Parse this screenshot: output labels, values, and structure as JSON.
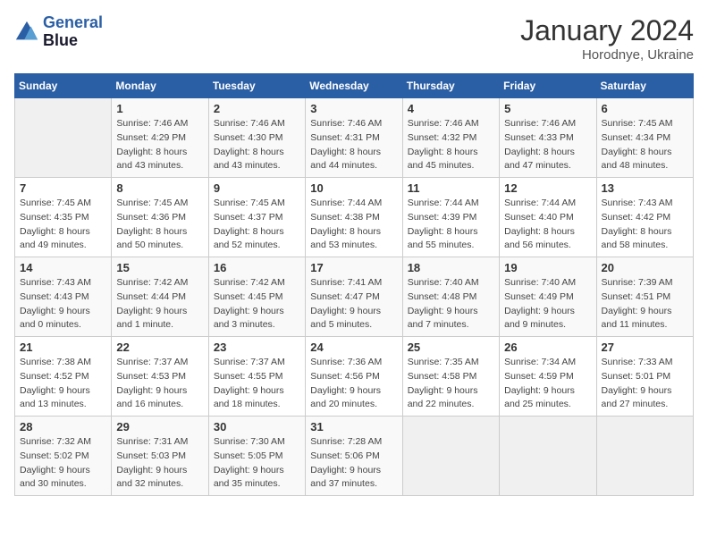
{
  "header": {
    "logo_line1": "General",
    "logo_line2": "Blue",
    "month_year": "January 2024",
    "location": "Horodnye, Ukraine"
  },
  "weekdays": [
    "Sunday",
    "Monday",
    "Tuesday",
    "Wednesday",
    "Thursday",
    "Friday",
    "Saturday"
  ],
  "weeks": [
    [
      {
        "day": "",
        "sunrise": "",
        "sunset": "",
        "daylight": ""
      },
      {
        "day": "1",
        "sunrise": "Sunrise: 7:46 AM",
        "sunset": "Sunset: 4:29 PM",
        "daylight": "Daylight: 8 hours and 43 minutes."
      },
      {
        "day": "2",
        "sunrise": "Sunrise: 7:46 AM",
        "sunset": "Sunset: 4:30 PM",
        "daylight": "Daylight: 8 hours and 43 minutes."
      },
      {
        "day": "3",
        "sunrise": "Sunrise: 7:46 AM",
        "sunset": "Sunset: 4:31 PM",
        "daylight": "Daylight: 8 hours and 44 minutes."
      },
      {
        "day": "4",
        "sunrise": "Sunrise: 7:46 AM",
        "sunset": "Sunset: 4:32 PM",
        "daylight": "Daylight: 8 hours and 45 minutes."
      },
      {
        "day": "5",
        "sunrise": "Sunrise: 7:46 AM",
        "sunset": "Sunset: 4:33 PM",
        "daylight": "Daylight: 8 hours and 47 minutes."
      },
      {
        "day": "6",
        "sunrise": "Sunrise: 7:45 AM",
        "sunset": "Sunset: 4:34 PM",
        "daylight": "Daylight: 8 hours and 48 minutes."
      }
    ],
    [
      {
        "day": "7",
        "sunrise": "Sunrise: 7:45 AM",
        "sunset": "Sunset: 4:35 PM",
        "daylight": "Daylight: 8 hours and 49 minutes."
      },
      {
        "day": "8",
        "sunrise": "Sunrise: 7:45 AM",
        "sunset": "Sunset: 4:36 PM",
        "daylight": "Daylight: 8 hours and 50 minutes."
      },
      {
        "day": "9",
        "sunrise": "Sunrise: 7:45 AM",
        "sunset": "Sunset: 4:37 PM",
        "daylight": "Daylight: 8 hours and 52 minutes."
      },
      {
        "day": "10",
        "sunrise": "Sunrise: 7:44 AM",
        "sunset": "Sunset: 4:38 PM",
        "daylight": "Daylight: 8 hours and 53 minutes."
      },
      {
        "day": "11",
        "sunrise": "Sunrise: 7:44 AM",
        "sunset": "Sunset: 4:39 PM",
        "daylight": "Daylight: 8 hours and 55 minutes."
      },
      {
        "day": "12",
        "sunrise": "Sunrise: 7:44 AM",
        "sunset": "Sunset: 4:40 PM",
        "daylight": "Daylight: 8 hours and 56 minutes."
      },
      {
        "day": "13",
        "sunrise": "Sunrise: 7:43 AM",
        "sunset": "Sunset: 4:42 PM",
        "daylight": "Daylight: 8 hours and 58 minutes."
      }
    ],
    [
      {
        "day": "14",
        "sunrise": "Sunrise: 7:43 AM",
        "sunset": "Sunset: 4:43 PM",
        "daylight": "Daylight: 9 hours and 0 minutes."
      },
      {
        "day": "15",
        "sunrise": "Sunrise: 7:42 AM",
        "sunset": "Sunset: 4:44 PM",
        "daylight": "Daylight: 9 hours and 1 minute."
      },
      {
        "day": "16",
        "sunrise": "Sunrise: 7:42 AM",
        "sunset": "Sunset: 4:45 PM",
        "daylight": "Daylight: 9 hours and 3 minutes."
      },
      {
        "day": "17",
        "sunrise": "Sunrise: 7:41 AM",
        "sunset": "Sunset: 4:47 PM",
        "daylight": "Daylight: 9 hours and 5 minutes."
      },
      {
        "day": "18",
        "sunrise": "Sunrise: 7:40 AM",
        "sunset": "Sunset: 4:48 PM",
        "daylight": "Daylight: 9 hours and 7 minutes."
      },
      {
        "day": "19",
        "sunrise": "Sunrise: 7:40 AM",
        "sunset": "Sunset: 4:49 PM",
        "daylight": "Daylight: 9 hours and 9 minutes."
      },
      {
        "day": "20",
        "sunrise": "Sunrise: 7:39 AM",
        "sunset": "Sunset: 4:51 PM",
        "daylight": "Daylight: 9 hours and 11 minutes."
      }
    ],
    [
      {
        "day": "21",
        "sunrise": "Sunrise: 7:38 AM",
        "sunset": "Sunset: 4:52 PM",
        "daylight": "Daylight: 9 hours and 13 minutes."
      },
      {
        "day": "22",
        "sunrise": "Sunrise: 7:37 AM",
        "sunset": "Sunset: 4:53 PM",
        "daylight": "Daylight: 9 hours and 16 minutes."
      },
      {
        "day": "23",
        "sunrise": "Sunrise: 7:37 AM",
        "sunset": "Sunset: 4:55 PM",
        "daylight": "Daylight: 9 hours and 18 minutes."
      },
      {
        "day": "24",
        "sunrise": "Sunrise: 7:36 AM",
        "sunset": "Sunset: 4:56 PM",
        "daylight": "Daylight: 9 hours and 20 minutes."
      },
      {
        "day": "25",
        "sunrise": "Sunrise: 7:35 AM",
        "sunset": "Sunset: 4:58 PM",
        "daylight": "Daylight: 9 hours and 22 minutes."
      },
      {
        "day": "26",
        "sunrise": "Sunrise: 7:34 AM",
        "sunset": "Sunset: 4:59 PM",
        "daylight": "Daylight: 9 hours and 25 minutes."
      },
      {
        "day": "27",
        "sunrise": "Sunrise: 7:33 AM",
        "sunset": "Sunset: 5:01 PM",
        "daylight": "Daylight: 9 hours and 27 minutes."
      }
    ],
    [
      {
        "day": "28",
        "sunrise": "Sunrise: 7:32 AM",
        "sunset": "Sunset: 5:02 PM",
        "daylight": "Daylight: 9 hours and 30 minutes."
      },
      {
        "day": "29",
        "sunrise": "Sunrise: 7:31 AM",
        "sunset": "Sunset: 5:03 PM",
        "daylight": "Daylight: 9 hours and 32 minutes."
      },
      {
        "day": "30",
        "sunrise": "Sunrise: 7:30 AM",
        "sunset": "Sunset: 5:05 PM",
        "daylight": "Daylight: 9 hours and 35 minutes."
      },
      {
        "day": "31",
        "sunrise": "Sunrise: 7:28 AM",
        "sunset": "Sunset: 5:06 PM",
        "daylight": "Daylight: 9 hours and 37 minutes."
      },
      {
        "day": "",
        "sunrise": "",
        "sunset": "",
        "daylight": ""
      },
      {
        "day": "",
        "sunrise": "",
        "sunset": "",
        "daylight": ""
      },
      {
        "day": "",
        "sunrise": "",
        "sunset": "",
        "daylight": ""
      }
    ]
  ]
}
